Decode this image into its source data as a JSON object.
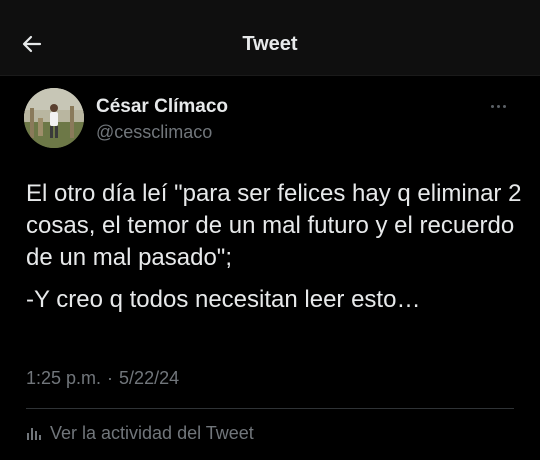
{
  "header": {
    "back_icon": "arrow-left-icon",
    "title": "Tweet"
  },
  "tweet": {
    "author": {
      "display_name": "César Clímaco",
      "handle": "@cessclimaco"
    },
    "more_icon": "more-horizontal-icon",
    "text": [
      "El otro día leí \"para ser felices hay q eliminar 2 cosas, el temor de un mal futuro y el recuerdo de un mal pasado\";",
      "-Y creo q todos necesitan leer esto…"
    ],
    "time": "1:25 p.m.",
    "separator": "·",
    "date": "5/22/24",
    "activity": {
      "icon": "bar-chart-icon",
      "label": "Ver la actividad del Tweet"
    }
  },
  "colors": {
    "background": "#000000",
    "header_background": "#0f0f0f",
    "text": "#e7e9ea",
    "secondary_text": "#71767b",
    "divider": "#2f3336"
  }
}
